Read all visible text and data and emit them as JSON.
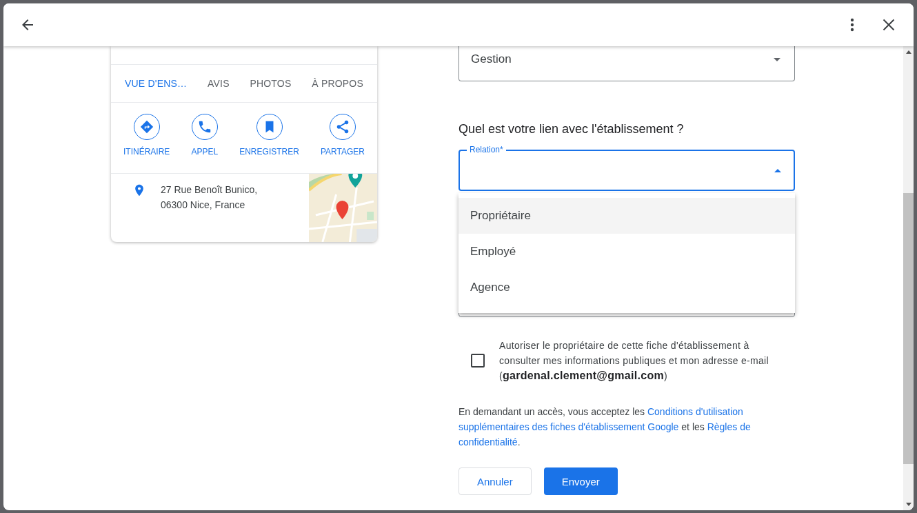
{
  "place_card": {
    "tabs": [
      {
        "label": "VUE D'ENS…",
        "selected": true
      },
      {
        "label": "AVIS",
        "selected": false
      },
      {
        "label": "PHOTOS",
        "selected": false
      },
      {
        "label": "À PROPOS",
        "selected": false
      }
    ],
    "actions": [
      {
        "label": "ITINÉRAIRE",
        "kind": "directions"
      },
      {
        "label": "APPEL",
        "kind": "call"
      },
      {
        "label": "ENREGISTRER",
        "kind": "save"
      },
      {
        "label": "PARTAGER",
        "kind": "share"
      }
    ],
    "address_lines": [
      "27 Rue Benoît Bunico,",
      "06300 Nice, France"
    ],
    "map": {
      "kind": "picture"
    }
  },
  "form": {
    "role_select": {
      "value": "Gestion"
    },
    "question": "Quel est votre lien avec l'établissement ?",
    "relation_select": {
      "label": "Relation*",
      "expanded": true,
      "options": [
        {
          "label": "Propriétaire",
          "selected": true
        },
        {
          "label": "Employé",
          "selected": false
        },
        {
          "label": "Agence",
          "selected": false
        }
      ]
    },
    "consent": {
      "checked": false,
      "text": "Autoriser le propriétaire de cette fiche d'établissement à consulter mes informations publiques et mon adresse e-mail (**gardenal.clement@gmail.com**)"
    },
    "terms": [
      {
        "kind": "text",
        "text": "En demandant un accès, vous acceptez les "
      },
      {
        "kind": "link",
        "text": "Conditions d'utilisation"
      },
      {
        "kind": "link",
        "text": "supplémentaires des fiches d'établissement Google"
      },
      {
        "kind": "text",
        "text": " et les "
      },
      {
        "kind": "link",
        "text": "Règles de"
      },
      {
        "kind": "link",
        "text": "confidentialité"
      },
      {
        "kind": "text",
        "text": "."
      }
    ],
    "buttons": [
      {
        "label": "Annuler",
        "kind": "secondary"
      },
      {
        "label": "Envoyer",
        "kind": "primary"
      }
    ]
  }
}
